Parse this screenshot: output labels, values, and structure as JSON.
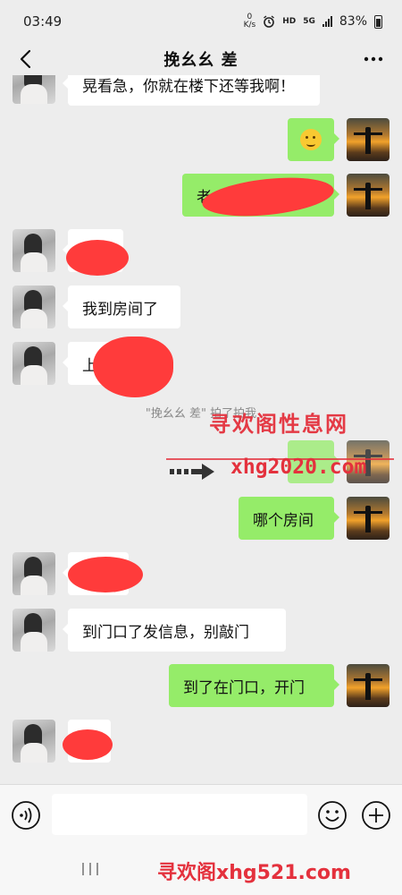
{
  "status_bar": {
    "time": "03:49",
    "net_speed_value": "0",
    "net_speed_unit": "K/s",
    "hd_label": "HD",
    "network_label": "5G",
    "battery_percent": "83%"
  },
  "header": {
    "title": "挽幺幺   差"
  },
  "messages": {
    "m0": {
      "side": "in",
      "text": "晃看急，你就在楼下还等我啊！"
    },
    "m1": {
      "side": "out",
      "emoji": "thinking-face-emoji"
    },
    "m2": {
      "side": "out",
      "text": "老"
    },
    "m3": {
      "side": "in",
      "text": ""
    },
    "m4": {
      "side": "in",
      "text": "我到房间了"
    },
    "m5": {
      "side": "in",
      "text": "上"
    },
    "m6": {
      "side": "out",
      "text": ""
    },
    "m7": {
      "side": "out",
      "text": "哪个房间"
    },
    "m8": {
      "side": "in",
      "text": ""
    },
    "m9": {
      "side": "in",
      "text": "到门口了发信息，别敲门"
    },
    "m10": {
      "side": "out",
      "text": "到了在门口，开门"
    },
    "m11": {
      "side": "in",
      "text": ""
    }
  },
  "system_message": "\"挽幺幺  差\" 拍了拍我",
  "watermarks": {
    "site_name": "寻欢阁性息网",
    "site_url": "xhg2020.com",
    "footer": "寻欢阁xhg521.com"
  },
  "colors": {
    "background": "#ededed",
    "outgoing_bubble": "#95ec69",
    "incoming_bubble": "#ffffff",
    "redaction": "#ff3b3b",
    "watermark": "#e4313d"
  }
}
